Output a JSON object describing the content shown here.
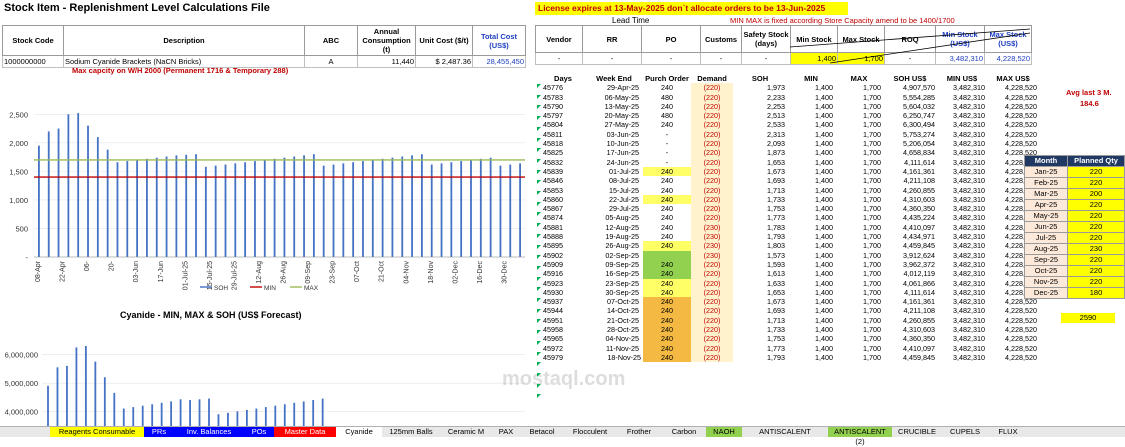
{
  "sheet_title": "Stock Item - Replenishment Level Calculations File",
  "license_notice": "License expires at 13-May-2025  don`t allocate orders to be 13-Jun-2025",
  "lead_time_label": "Lead Time",
  "minmax_note": "MIN MAX is fixed according Store Capacity amend to be 1400/1700",
  "item_headers": [
    "Stock Code",
    "Description",
    "ABC",
    "Annual Consumption (t)",
    "Unit Cost ($/t)",
    "Total Cost (US$)"
  ],
  "item_values": [
    "1000000000",
    "Sodium Cyanide Brackets (NaCN Bricks)",
    "A",
    "11,440",
    "$   2,487.36",
    "28,455,450"
  ],
  "replen_headers": [
    "Vendor",
    "RR",
    "PO",
    "Customs",
    "Safety Stock (days)",
    "Min Stock",
    "Max Stock",
    "ROQ",
    "Min Stock (US$)",
    "Max Stock (US$)"
  ],
  "replen_values": [
    "-",
    "-",
    "-",
    "-",
    "-",
    "1,400",
    "1,700",
    "-",
    "3,482,310",
    "4,228,520"
  ],
  "capacity_note": "Max capcity on W/H 2000 (Permanent 1716 & Temporary 288)",
  "grid_headers": [
    "Days",
    "Week End",
    "Purch Order",
    "Demand",
    "SOH",
    "MIN",
    "MAX",
    "SOH US$",
    "MIN US$",
    "MAX US$"
  ],
  "grid_rows": [
    [
      "45776",
      "29-Apr-25",
      "240",
      "(220)",
      "1,973",
      "1,400",
      "1,700",
      "4,907,570",
      "3,482,310",
      "4,228,520",
      "w"
    ],
    [
      "45783",
      "06-May-25",
      "480",
      "(220)",
      "2,233",
      "1,400",
      "1,700",
      "5,554,285",
      "3,482,310",
      "4,228,520",
      "w"
    ],
    [
      "45790",
      "13-May-25",
      "240",
      "(220)",
      "2,253",
      "1,400",
      "1,700",
      "5,604,032",
      "3,482,310",
      "4,228,520",
      "w"
    ],
    [
      "45797",
      "20-May-25",
      "480",
      "(220)",
      "2,513",
      "1,400",
      "1,700",
      "6,250,747",
      "3,482,310",
      "4,228,520",
      "w"
    ],
    [
      "45804",
      "27-May-25",
      "240",
      "(220)",
      "2,533",
      "1,400",
      "1,700",
      "6,300,494",
      "3,482,310",
      "4,228,520",
      "w"
    ],
    [
      "45811",
      "03-Jun-25",
      "-",
      "(220)",
      "2,313",
      "1,400",
      "1,700",
      "5,753,274",
      "3,482,310",
      "4,228,520",
      "w"
    ],
    [
      "45818",
      "10-Jun-25",
      "-",
      "(220)",
      "2,093",
      "1,400",
      "1,700",
      "5,206,054",
      "3,482,310",
      "4,228,520",
      "w"
    ],
    [
      "45825",
      "17-Jun-25",
      "-",
      "(220)",
      "1,873",
      "1,400",
      "1,700",
      "4,658,834",
      "3,482,310",
      "4,228,520",
      "w"
    ],
    [
      "45832",
      "24-Jun-25",
      "-",
      "(220)",
      "1,653",
      "1,400",
      "1,700",
      "4,111,614",
      "3,482,310",
      "4,228,520",
      "w"
    ],
    [
      "45839",
      "01-Jul-25",
      "240",
      "(220)",
      "1,673",
      "1,400",
      "1,700",
      "4,161,361",
      "3,482,310",
      "4,228,520",
      "y"
    ],
    [
      "45846",
      "08-Jul-25",
      "240",
      "(220)",
      "1,693",
      "1,400",
      "1,700",
      "4,211,108",
      "3,482,310",
      "4,228,520",
      "w"
    ],
    [
      "45853",
      "15-Jul-25",
      "240",
      "(220)",
      "1,713",
      "1,400",
      "1,700",
      "4,260,855",
      "3,482,310",
      "4,228,520",
      "w"
    ],
    [
      "45860",
      "22-Jul-25",
      "240",
      "(220)",
      "1,733",
      "1,400",
      "1,700",
      "4,310,603",
      "3,482,310",
      "4,228,520",
      "y"
    ],
    [
      "45867",
      "29-Jul-25",
      "240",
      "(220)",
      "1,753",
      "1,400",
      "1,700",
      "4,360,350",
      "3,482,310",
      "4,228,520",
      "w"
    ],
    [
      "45874",
      "05-Aug-25",
      "240",
      "(220)",
      "1,773",
      "1,400",
      "1,700",
      "4,435,224",
      "3,482,310",
      "4,228,520",
      "w"
    ],
    [
      "45881",
      "12-Aug-25",
      "240",
      "(230)",
      "1,783",
      "1,400",
      "1,700",
      "4,410,097",
      "3,482,310",
      "4,228,520",
      "w"
    ],
    [
      "45888",
      "19-Aug-25",
      "240",
      "(230)",
      "1,793",
      "1,400",
      "1,700",
      "4,434,971",
      "3,482,310",
      "4,228,520",
      "w"
    ],
    [
      "45895",
      "26-Aug-25",
      "240",
      "(230)",
      "1,803",
      "1,400",
      "1,700",
      "4,459,845",
      "3,482,310",
      "4,228,520",
      "y"
    ],
    [
      "45902",
      "02-Sep-25",
      "",
      "(230)",
      "1,573",
      "1,400",
      "1,700",
      "3,912,624",
      "3,482,310",
      "4,228,520",
      "g"
    ],
    [
      "45909",
      "09-Sep-25",
      "240",
      "(220)",
      "1,593",
      "1,400",
      "1,700",
      "3,962,372",
      "3,482,310",
      "4,228,520",
      "g"
    ],
    [
      "45916",
      "16-Sep-25",
      "240",
      "(220)",
      "1,613",
      "1,400",
      "1,700",
      "4,012,119",
      "3,482,310",
      "4,228,520",
      "g"
    ],
    [
      "45923",
      "23-Sep-25",
      "240",
      "(220)",
      "1,633",
      "1,400",
      "1,700",
      "4,061,866",
      "3,482,310",
      "4,228,520",
      "y"
    ],
    [
      "45930",
      "30-Sep-25",
      "240",
      "(220)",
      "1,653",
      "1,400",
      "1,700",
      "4,111,614",
      "3,482,310",
      "4,228,520",
      "y"
    ],
    [
      "45937",
      "07-Oct-25",
      "240",
      "(220)",
      "1,673",
      "1,400",
      "1,700",
      "4,161,361",
      "3,482,310",
      "4,228,520",
      "o"
    ],
    [
      "45944",
      "14-Oct-25",
      "240",
      "(220)",
      "1,693",
      "1,400",
      "1,700",
      "4,211,108",
      "3,482,310",
      "4,228,520",
      "o"
    ],
    [
      "45951",
      "21-Oct-25",
      "240",
      "(220)",
      "1,713",
      "1,400",
      "1,700",
      "4,260,855",
      "3,482,310",
      "4,228,520",
      "o"
    ],
    [
      "45958",
      "28-Oct-25",
      "240",
      "(220)",
      "1,733",
      "1,400",
      "1,700",
      "4,310,603",
      "3,482,310",
      "4,228,520",
      "o"
    ],
    [
      "45965",
      "04-Nov-25",
      "240",
      "(220)",
      "1,753",
      "1,400",
      "1,700",
      "4,360,350",
      "3,482,310",
      "4,228,520",
      "o"
    ],
    [
      "45972",
      "11-Nov-25",
      "240",
      "(220)",
      "1,773",
      "1,400",
      "1,700",
      "4,410,097",
      "3,482,310",
      "4,228,520",
      "o"
    ],
    [
      "45979",
      "18-Nov-25",
      "240",
      "(220)",
      "1,793",
      "1,400",
      "1,700",
      "4,459,845",
      "3,482,310",
      "4,228,520",
      "o"
    ]
  ],
  "avg_label": "Avg last 3 M.",
  "avg_value": "184.6",
  "month_headers": [
    "Month",
    "Planned Qty"
  ],
  "month_rows": [
    [
      "Jan-25",
      "220"
    ],
    [
      "Feb-25",
      "220"
    ],
    [
      "Mar-25",
      "200"
    ],
    [
      "Apr-25",
      "220"
    ],
    [
      "May-25",
      "220"
    ],
    [
      "Jun-25",
      "220"
    ],
    [
      "Jul-25",
      "220"
    ],
    [
      "Aug-25",
      "230"
    ],
    [
      "Sep-25",
      "220"
    ],
    [
      "Oct-25",
      "220"
    ],
    [
      "Nov-25",
      "220"
    ],
    [
      "Dec-25",
      "180"
    ]
  ],
  "planned_total": "2590",
  "watermark": "mostaql.com",
  "tabs": [
    {
      "label": "Reagents Consumable",
      "bg": "#ffff00",
      "fg": "#000000"
    },
    {
      "label": "PRs",
      "bg": "#0000ff",
      "fg": "#ffffff"
    },
    {
      "label": "Inv. Balances",
      "bg": "#0000ff",
      "fg": "#ffffff"
    },
    {
      "label": "POs",
      "bg": "#0000ff",
      "fg": "#ffffff"
    },
    {
      "label": "Master Data",
      "bg": "#ff0000",
      "fg": "#ffffff"
    },
    {
      "label": "Cyanide",
      "bg": "#ffffff",
      "fg": "#000000"
    },
    {
      "label": "125mm Balls",
      "bg": "#e8e8e8",
      "fg": "#000000"
    },
    {
      "label": "Ceramic M",
      "bg": "#e8e8e8",
      "fg": "#000000"
    },
    {
      "label": "PAX",
      "bg": "#e8e8e8",
      "fg": "#000000"
    },
    {
      "label": "Betacol",
      "bg": "#e8e8e8",
      "fg": "#000000"
    },
    {
      "label": "Flocculent",
      "bg": "#e8e8e8",
      "fg": "#000000"
    },
    {
      "label": "Frother",
      "bg": "#e8e8e8",
      "fg": "#000000"
    },
    {
      "label": "Carbon",
      "bg": "#e8e8e8",
      "fg": "#000000"
    },
    {
      "label": "NAOH",
      "bg": "#92d050",
      "fg": "#000000"
    },
    {
      "label": "ANTISCALENT",
      "bg": "#e8e8e8",
      "fg": "#000000"
    },
    {
      "label": "ANTISCALENT (2)",
      "bg": "#92d050",
      "fg": "#000000"
    },
    {
      "label": "CRUCIBLE",
      "bg": "#e8e8e8",
      "fg": "#000000"
    },
    {
      "label": "CUPELS",
      "bg": "#e8e8e8",
      "fg": "#000000"
    },
    {
      "label": "FLUX",
      "bg": "#e8e8e8",
      "fg": "#000000"
    }
  ],
  "chart_data": [
    {
      "type": "bar",
      "title": "",
      "ylim": [
        0,
        2750
      ],
      "yticks": [
        "2,500",
        "2,000",
        "1,500",
        "1,000",
        "500",
        "-"
      ],
      "ytick_values": [
        2500,
        2000,
        1500,
        1000,
        500,
        0
      ],
      "xticks": [
        "08-Apr",
        "22-Apr",
        "06-",
        "20-",
        "03-Jun",
        "17-Jun",
        "01-Jul-25",
        "15-Jul-25",
        "29-Jul-25",
        "12-Aug",
        "26-Aug",
        "09-Sep",
        "23-Sep",
        "07-Oct",
        "21-Oct",
        "04-Nov",
        "18-Nov",
        "02-Dec",
        "16-Dec",
        "30-Dec"
      ],
      "series": [
        {
          "name": "SOH",
          "values": [
            1950,
            2200,
            2250,
            2500,
            2520,
            2300,
            2100,
            1880,
            1660,
            1680,
            1700,
            1720,
            1740,
            1760,
            1780,
            1790,
            1800,
            1580,
            1600,
            1620,
            1640,
            1660,
            1680,
            1700,
            1720,
            1740,
            1760,
            1780,
            1800,
            1600,
            1620,
            1640,
            1660,
            1680,
            1700,
            1720,
            1740,
            1760,
            1780,
            1800,
            1620,
            1640,
            1660,
            1680,
            1700,
            1720,
            1740,
            1600,
            1620,
            1640
          ]
        },
        {
          "name": "MIN",
          "value": 1400
        },
        {
          "name": "MAX",
          "value": 1700
        }
      ]
    },
    {
      "type": "bar",
      "title": "Cyanide - MIN, MAX & SOH (US$ Forecast)",
      "ylim": [
        3500000,
        7000000
      ],
      "yticks": [
        "6,000,000",
        "5,000,000",
        "4,000,000"
      ],
      "ytick_values": [
        6000000,
        5000000,
        4000000
      ],
      "series": [
        {
          "name": "SOH US$",
          "values": [
            4907570,
            5554285,
            5604032,
            6250747,
            6300494,
            5753274,
            5206054,
            4658834,
            4111614,
            4161361,
            4211108,
            4260855,
            4310603,
            4360350,
            4435224,
            4410097,
            4434971,
            4459845,
            3912624,
            3962372,
            4012119,
            4061866,
            4111614,
            4161361,
            4211108,
            4260855,
            4310603,
            4360350,
            4410097,
            4459845
          ]
        }
      ]
    }
  ]
}
